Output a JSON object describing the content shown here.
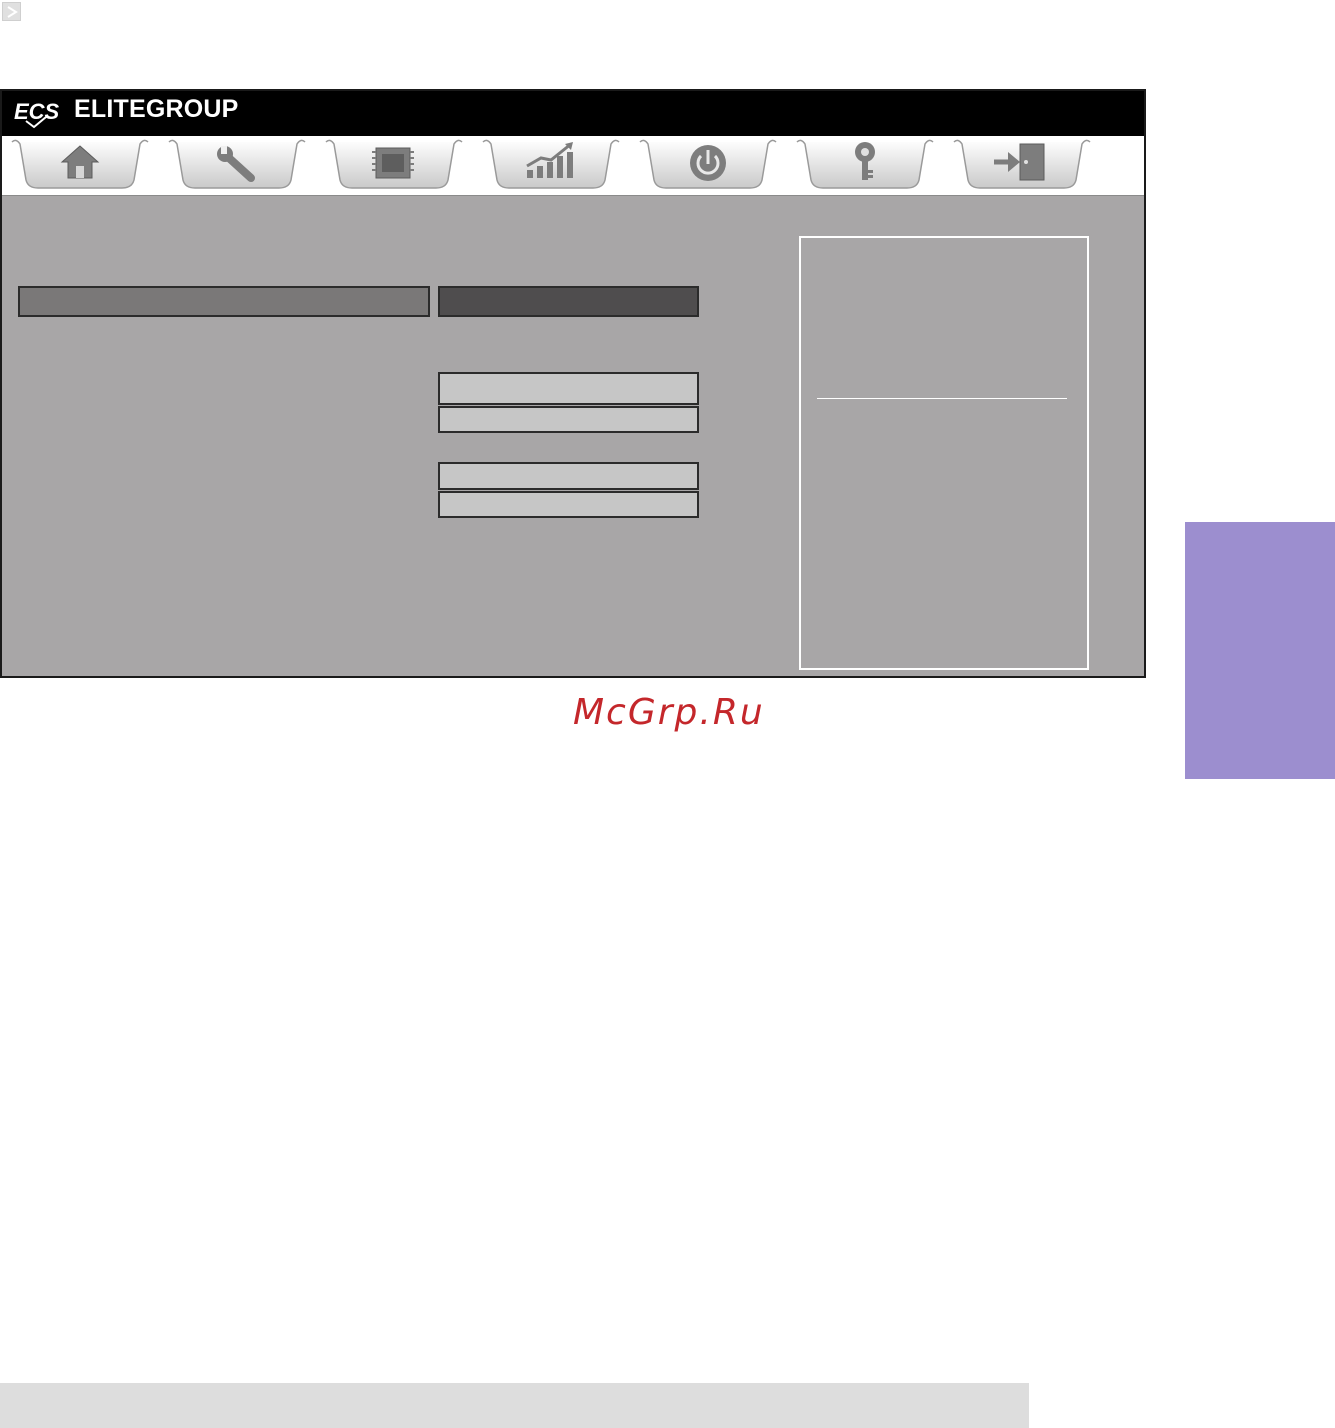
{
  "header": {
    "brand_name": "ELITEGROUP",
    "logo_text": "ECS"
  },
  "tabs": [
    {
      "id": "main",
      "icon": "home-icon"
    },
    {
      "id": "advanced",
      "icon": "wrench-icon"
    },
    {
      "id": "chipset",
      "icon": "chip-icon"
    },
    {
      "id": "mi",
      "icon": "chart-up-icon"
    },
    {
      "id": "boot",
      "icon": "power-icon"
    },
    {
      "id": "security",
      "icon": "key-icon"
    },
    {
      "id": "exit",
      "icon": "exit-door-icon"
    }
  ],
  "colors": {
    "panel_bg": "#a8a6a7",
    "side_tab": "#9c8ecf",
    "watermark": "#c4272b",
    "footer": "#dddddd"
  },
  "watermark": {
    "text": "McGrp.Ru"
  }
}
